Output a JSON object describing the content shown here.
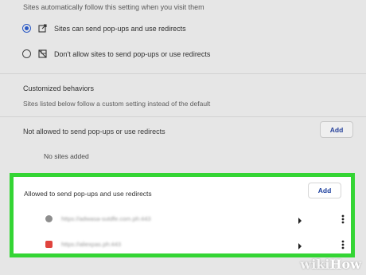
{
  "intro": "Sites automatically follow this setting when you visit them",
  "options": [
    {
      "label": "Sites can send pop-ups and use redirects",
      "selected": true,
      "icon": "external-link-icon"
    },
    {
      "label": "Don't allow sites to send pop-ups or use redirects",
      "selected": false,
      "icon": "blocked-popup-icon"
    }
  ],
  "customized": {
    "title": "Customized behaviors",
    "subtitle": "Sites listed below follow a custom setting instead of the default"
  },
  "not_allowed": {
    "label": "Not allowed to send pop-ups or use redirects",
    "add_label": "Add",
    "empty_text": "No sites added"
  },
  "allowed": {
    "label": "Allowed to send pop-ups and use redirects",
    "add_label": "Add",
    "sites": [
      {
        "url": "https://adwasa-sutdfe.com.ph:443",
        "favicon_color": "#8e8e8e"
      },
      {
        "url": "https://aliexpas.ph:443",
        "favicon_color": "#e0443d"
      }
    ]
  },
  "colors": {
    "accent": "#2a59c5",
    "highlight": "#34d534",
    "button_text": "#1c3f9e"
  },
  "watermark": {
    "part1": "wiki",
    "part2": "How"
  }
}
